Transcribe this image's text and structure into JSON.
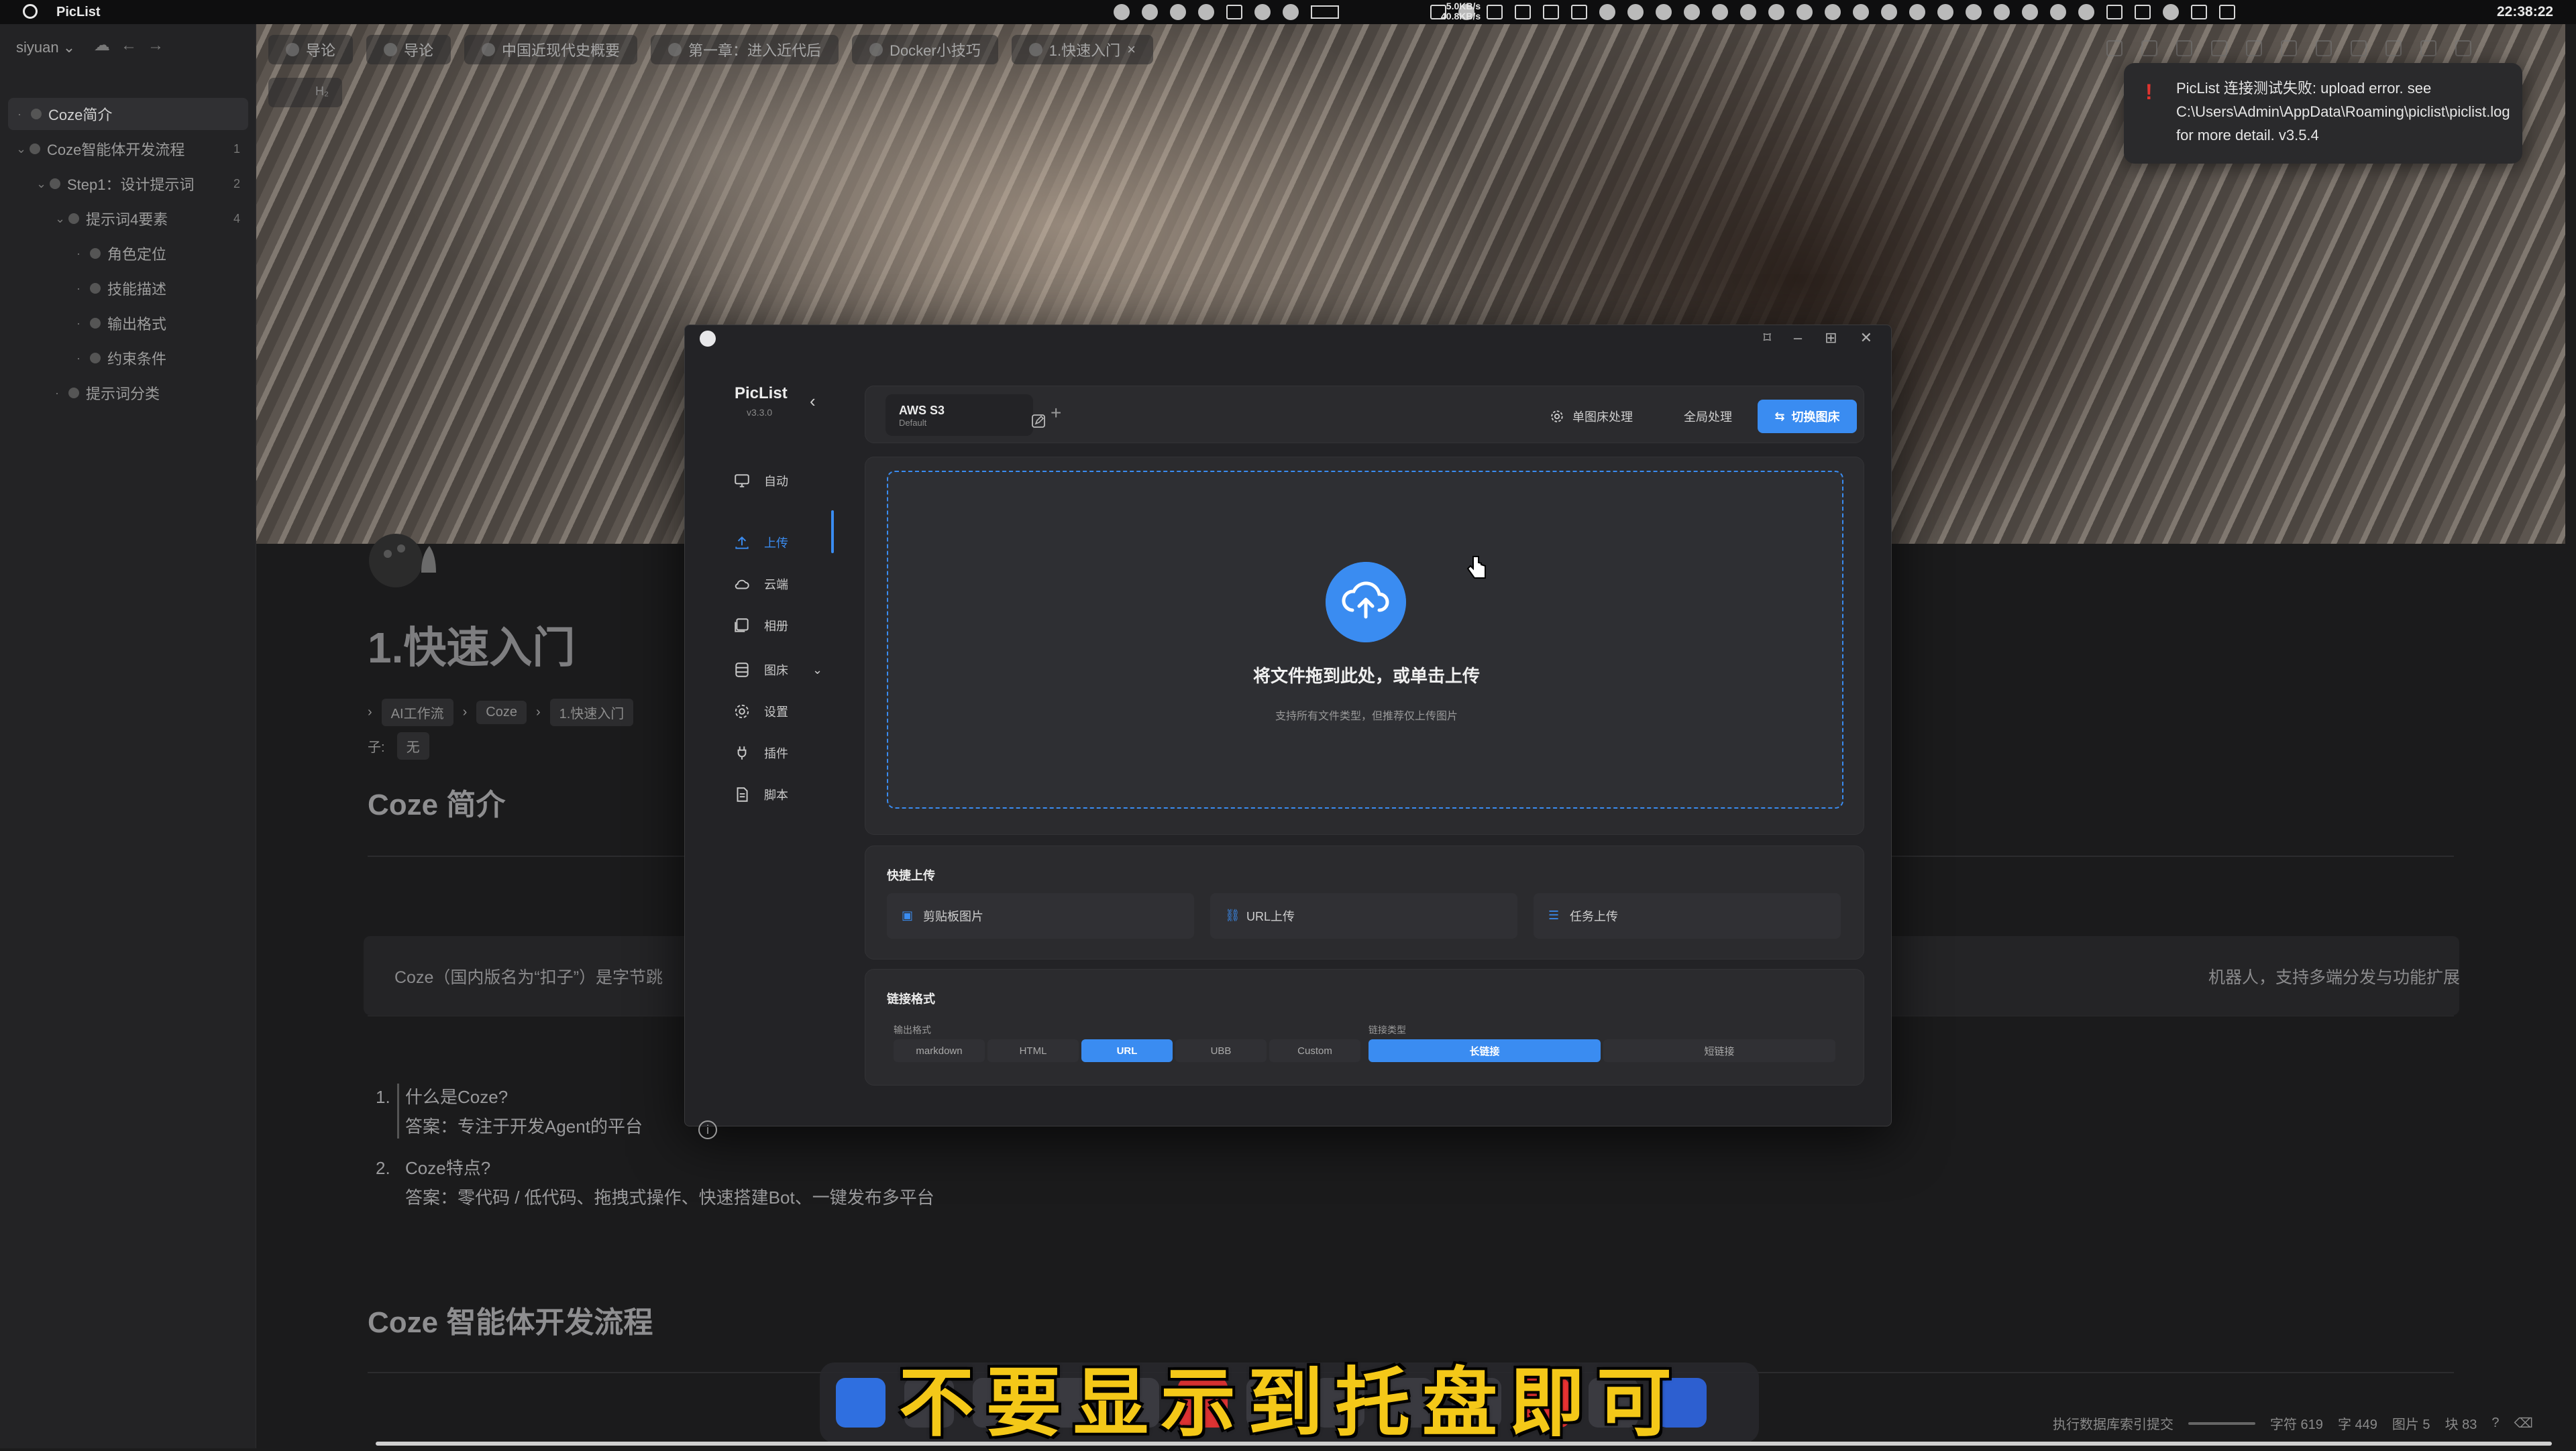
{
  "menubar": {
    "app_name": "PicList",
    "net_up": "5.0KB/s",
    "net_down": "40.8KB/s",
    "clock": "22:38:22"
  },
  "sidebar": {
    "workspace": "siyuan",
    "items": [
      {
        "label": "Coze简介",
        "count": ""
      },
      {
        "label": "Coze智能体开发流程",
        "count": "1"
      },
      {
        "label": "Step1：设计提示词",
        "count": "2"
      },
      {
        "label": "提示词4要素",
        "count": "4"
      },
      {
        "label": "角色定位",
        "count": ""
      },
      {
        "label": "技能描述",
        "count": ""
      },
      {
        "label": "输出格式",
        "count": ""
      },
      {
        "label": "约束条件",
        "count": ""
      },
      {
        "label": "提示词分类",
        "count": ""
      }
    ]
  },
  "doc": {
    "tabs": [
      "导论",
      "导论",
      "中国近现代史概要",
      "第一章：进入近代后",
      "Docker小技巧",
      "1.快速入门"
    ],
    "breadcrumb_hint": "H₂",
    "title": "1.快速入门",
    "tags": [
      "AI工作流",
      "Coze",
      "1.快速入门"
    ],
    "attr_label": "子:",
    "attr_value": "无",
    "h2_intro": "Coze 简介",
    "quote_left": "Coze（国内版名为“扣子”）是字节跳",
    "quote_right": "机器人，支持多端分发与功能扩展，适配个人、团队及企业级场景。",
    "list": [
      {
        "num": "1.",
        "q": "什么是Coze?",
        "a": "答案：专注于开发Agent的平台"
      },
      {
        "num": "2.",
        "q": "Coze特点?",
        "a": "答案：零代码 / 低代码、拖拽式操作、快速搭建Bot、一键发布多平台"
      }
    ],
    "h2_flow": "Coze 智能体开发流程"
  },
  "toast": {
    "text": "PicList 连接测试失败: upload error. see C:\\Users\\Admin\\AppData\\Roaming\\piclist\\piclist.log for more detail. v3.5.4"
  },
  "piclist": {
    "title": "PicList",
    "version": "v3.3.0",
    "nav": [
      {
        "label": "自动",
        "icon": "monitor-icon"
      },
      {
        "label": "上传",
        "icon": "upload-icon"
      },
      {
        "label": "云端",
        "icon": "cloud-icon"
      },
      {
        "label": "相册",
        "icon": "gallery-icon"
      },
      {
        "label": "图床",
        "icon": "database-icon"
      },
      {
        "label": "设置",
        "icon": "gear-icon"
      },
      {
        "label": "插件",
        "icon": "plug-icon"
      },
      {
        "label": "脚本",
        "icon": "script-icon"
      }
    ],
    "picbed_name": "AWS S3",
    "picbed_config": "Default",
    "btn_single": "单图床处理",
    "btn_global": "全局处理",
    "btn_switch": "切换图床",
    "drop_main": "将文件拖到此处，或单击上传",
    "drop_sub": "支持所有文件类型，但推荐仅上传图片",
    "quick_title": "快捷上传",
    "quick": [
      "剪贴板图片",
      "URL上传",
      "任务上传"
    ],
    "fmt_title": "链接格式",
    "fmt_label": "输出格式",
    "link_label": "链接类型",
    "formats": [
      "markdown",
      "HTML",
      "URL",
      "UBB",
      "Custom"
    ],
    "format_selected": "URL",
    "link_types": [
      "长链接",
      "短链接"
    ],
    "link_selected": "长链接",
    "accent": "#3a8cf1"
  },
  "subtitle": "不要显示到托盘即可",
  "statusbar": {
    "index": "执行数据库索引提交",
    "chars": "字符 619",
    "words": "字 449",
    "images": "图片 5",
    "blocks": "块 83"
  }
}
